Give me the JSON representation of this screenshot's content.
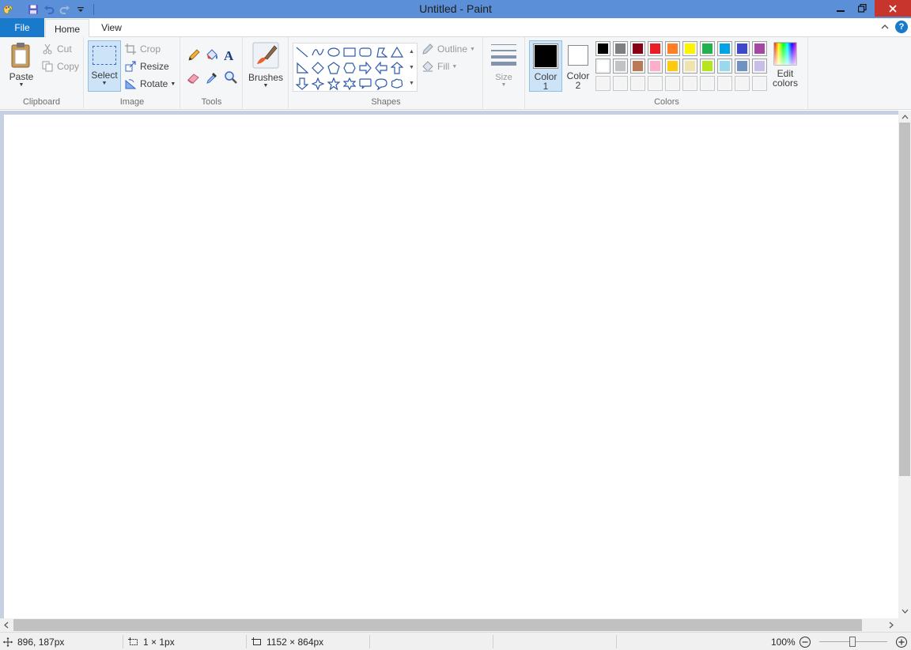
{
  "window": {
    "title": "Untitled - Paint"
  },
  "tabs": {
    "file": "File",
    "home": "Home",
    "view": "View"
  },
  "ribbon": {
    "clipboard": {
      "label": "Clipboard",
      "paste": "Paste",
      "cut": "Cut",
      "copy": "Copy"
    },
    "image": {
      "label": "Image",
      "select": "Select",
      "crop": "Crop",
      "resize": "Resize",
      "rotate": "Rotate"
    },
    "tools": {
      "label": "Tools"
    },
    "brushes": {
      "label": "Brushes"
    },
    "shapes": {
      "label": "Shapes",
      "outline": "Outline",
      "fill": "Fill"
    },
    "size": {
      "label": "Size"
    },
    "colors": {
      "label": "Colors",
      "color1_line1": "Color",
      "color1_line2": "1",
      "color2_line1": "Color",
      "color2_line2": "2",
      "edit_line1": "Edit",
      "edit_line2": "colors",
      "color1_value": "#000000",
      "color2_value": "#ffffff",
      "palette_row1": [
        "#000000",
        "#7f7f7f",
        "#880015",
        "#ed1c24",
        "#ff7f27",
        "#fff200",
        "#22b14c",
        "#00a2e8",
        "#3f48cc",
        "#a349a4"
      ],
      "palette_row2": [
        "#ffffff",
        "#c3c3c3",
        "#b97a57",
        "#ffaec9",
        "#ffc90e",
        "#efe4b0",
        "#b5e61d",
        "#99d9ea",
        "#7092be",
        "#c8bfe7"
      ],
      "palette_row3": [
        "#f4f4f4",
        "#f4f4f4",
        "#f4f4f4",
        "#f4f4f4",
        "#f4f4f4",
        "#f4f4f4",
        "#f4f4f4",
        "#f4f4f4",
        "#f4f4f4",
        "#f4f4f4"
      ]
    }
  },
  "status": {
    "cursor_position": "896, 187px",
    "selection_size": "1 × 1px",
    "image_size": "1152 × 864px",
    "zoom": "100%"
  }
}
